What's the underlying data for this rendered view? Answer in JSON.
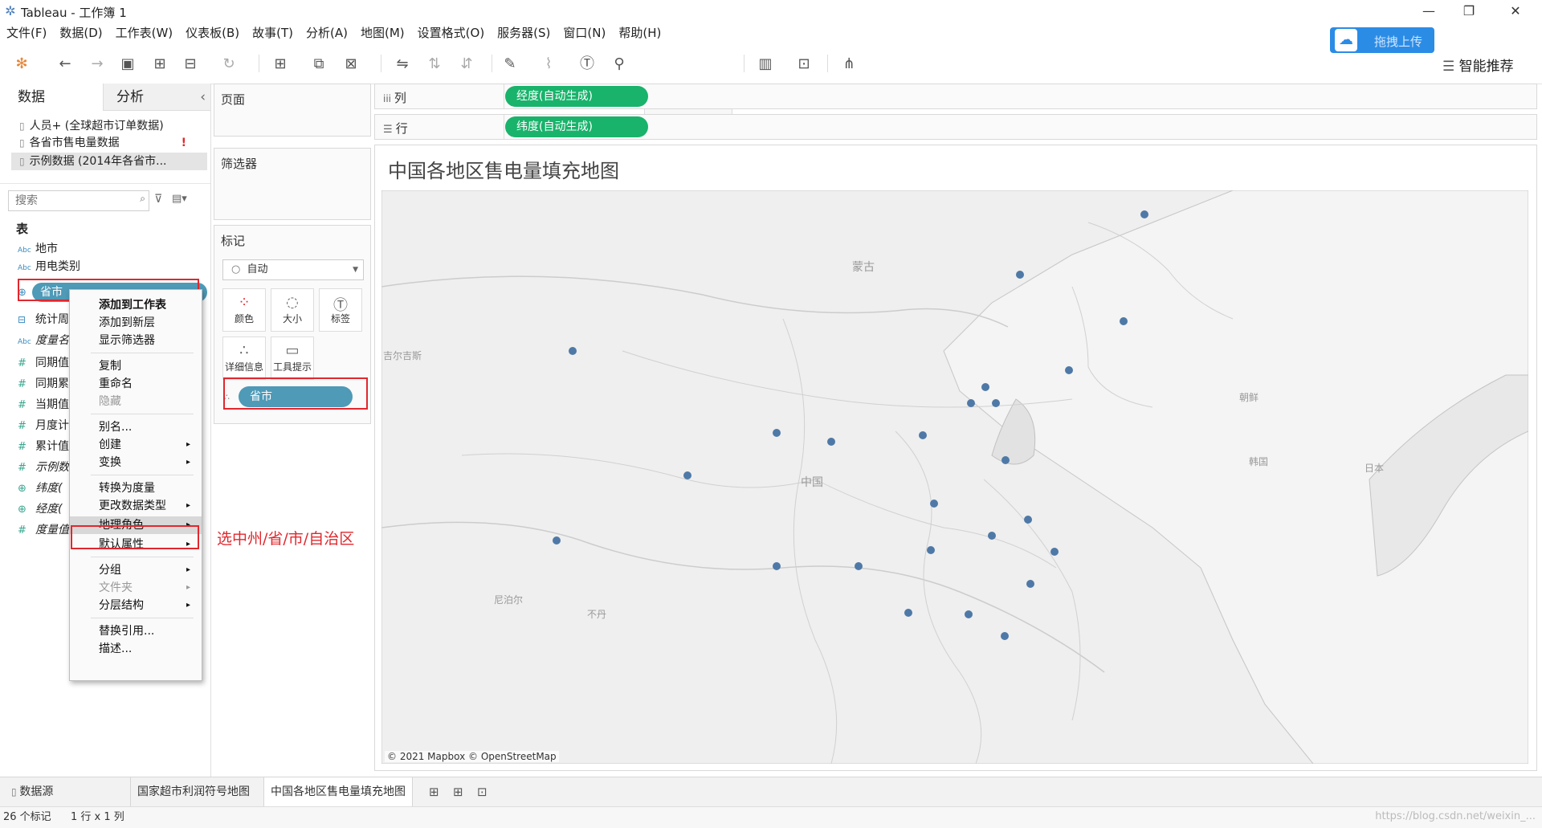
{
  "window": {
    "title": "Tableau - 工作簿 1",
    "minimize": "—",
    "maximize": "❐",
    "close": "✕"
  },
  "menu": [
    "文件(F)",
    "数据(D)",
    "工作表(W)",
    "仪表板(B)",
    "故事(T)",
    "分析(A)",
    "地图(M)",
    "设置格式(O)",
    "服务器(S)",
    "窗口(N)",
    "帮助(H)"
  ],
  "toolbar": {
    "upload_label": "拖拽上传",
    "smart_label": "智能推荐",
    "icons": [
      "tableau-logo-icon",
      "undo-icon",
      "redo-icon",
      "save-icon",
      "new-datasource-icon",
      "pause-updates-icon",
      "refresh-icon",
      "new-worksheet-icon",
      "duplicate-icon",
      "clear-icon",
      "swap-icon",
      "sort-asc-icon",
      "sort-desc-icon",
      "highlight-icon",
      "group-icon",
      "label-icon",
      "pin-icon",
      "fit-icon",
      "presentation-icon",
      "share-icon"
    ]
  },
  "left_pane": {
    "tab_data": "数据",
    "tab_analysis": "分析",
    "collapse": "‹",
    "datasources": [
      {
        "label": "人员+ (全球超市订单数据)",
        "warning": ""
      },
      {
        "label": "各省市售电量数据",
        "warning": "!"
      },
      {
        "label": "示例数据 (2014年各省市...",
        "warning": ""
      }
    ],
    "search_placeholder": "搜索",
    "tables_header": "表",
    "fields": [
      {
        "type": "Abc",
        "name": "地市"
      },
      {
        "type": "Abc",
        "name": "用电类别"
      },
      {
        "type": "⊕",
        "name": "省市"
      },
      {
        "type": "⊟",
        "name": "统计周"
      },
      {
        "type": "Abc",
        "name": "度量名"
      },
      {
        "type": "#",
        "name": "同期值"
      },
      {
        "type": "#",
        "name": "同期累"
      },
      {
        "type": "#",
        "name": "当期值"
      },
      {
        "type": "#",
        "name": "月度计"
      },
      {
        "type": "#",
        "name": "累计值"
      },
      {
        "type": "#",
        "name": "示例数"
      },
      {
        "type": "⊕",
        "name": "纬度("
      },
      {
        "type": "⊕",
        "name": "经度("
      },
      {
        "type": "#",
        "name": "度量值"
      }
    ]
  },
  "cards": {
    "pages": "页面",
    "filters": "筛选器",
    "marks": "标记",
    "mark_type": "自动",
    "mark_buttons": [
      "颜色",
      "大小",
      "标签",
      "详细信息",
      "工具提示"
    ],
    "mark_pill": "省市"
  },
  "shelves": {
    "columns_label": "列",
    "rows_label": "行",
    "columns_pill": "经度(自动生成)",
    "rows_pill": "纬度(自动生成)"
  },
  "view": {
    "title": "中国各地区售电量填充地图",
    "attribution": "© 2021 Mapbox © OpenStreetMap",
    "map_labels": [
      "蒙古",
      "中国",
      "朝鲜",
      "韩国",
      "日本",
      "尼泊尔",
      "不丹",
      "吉尔吉斯"
    ]
  },
  "context_menu": {
    "items": [
      {
        "label": "添加到工作表",
        "arrow": "",
        "disabled": false,
        "bold": true
      },
      {
        "label": "添加到新层",
        "arrow": "",
        "disabled": false
      },
      {
        "label": "显示筛选器",
        "arrow": "",
        "disabled": false
      },
      {
        "label": "复制",
        "arrow": "",
        "disabled": false
      },
      {
        "label": "重命名",
        "arrow": "",
        "disabled": false
      },
      {
        "label": "隐藏",
        "arrow": "",
        "disabled": true
      },
      {
        "label": "别名...",
        "arrow": "",
        "disabled": false
      },
      {
        "label": "创建",
        "arrow": "▸",
        "disabled": false
      },
      {
        "label": "变换",
        "arrow": "▸",
        "disabled": false
      },
      {
        "label": "转换为度量",
        "arrow": "",
        "disabled": false
      },
      {
        "label": "更改数据类型",
        "arrow": "▸",
        "disabled": false
      },
      {
        "label": "地理角色",
        "arrow": "▸",
        "disabled": false
      },
      {
        "label": "默认属性",
        "arrow": "▸",
        "disabled": false
      },
      {
        "label": "分组",
        "arrow": "▸",
        "disabled": false
      },
      {
        "label": "文件夹",
        "arrow": "▸",
        "disabled": true
      },
      {
        "label": "分层结构",
        "arrow": "▸",
        "disabled": false
      },
      {
        "label": "替换引用...",
        "arrow": "",
        "disabled": false
      },
      {
        "label": "描述...",
        "arrow": "",
        "disabled": false
      }
    ]
  },
  "annotation": "选中州/省/市/自治区",
  "sheet_tabs": {
    "datasource": "数据源",
    "tabs": [
      "国家超市利润符号地图",
      "中国各地区售电量填充地图"
    ],
    "new_sheet_icons": [
      "new-worksheet-icon",
      "new-dashboard-icon",
      "new-story-icon"
    ]
  },
  "status": {
    "marks": "26 个标记",
    "rows_cols": "1 行 x 1 列"
  },
  "watermark": "https://blog.csdn.net/weixin_..."
}
